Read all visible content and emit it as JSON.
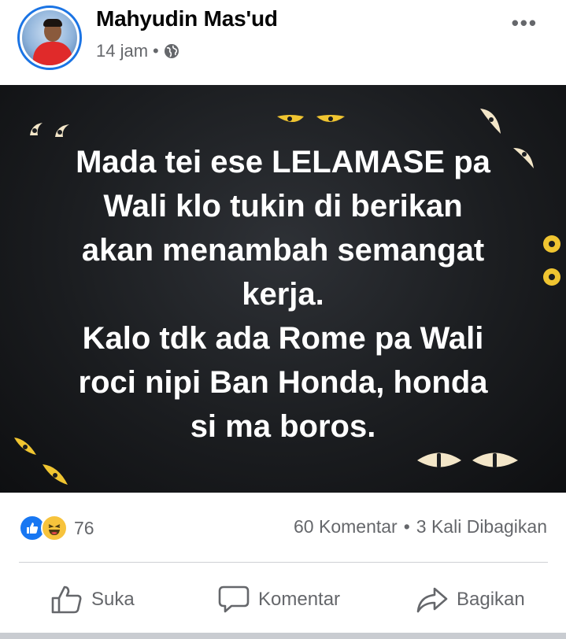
{
  "post": {
    "author": "Mahyudin Mas'ud",
    "time": "14 jam",
    "separator": "•",
    "privacy_icon": "globe-icon",
    "more_label": "•••"
  },
  "image_text": {
    "lines": [
      "Mada tei ese LELAMASE pa",
      "Wali klo tukin di berikan",
      "akan menambah semangat",
      "kerja.",
      "Kalo tdk ada Rome pa Wali",
      "roci nipi Ban Honda, honda",
      "si ma boros."
    ]
  },
  "stats": {
    "reaction_icons": [
      "like-icon",
      "haha-icon"
    ],
    "reaction_count": "76",
    "comments": "60 Komentar",
    "dot": "•",
    "shares": "3 Kali Dibagikan"
  },
  "actions": {
    "like": "Suka",
    "comment": "Komentar",
    "share": "Bagikan"
  },
  "colors": {
    "brand_blue": "#1877f2",
    "meta_gray": "#65676b",
    "eye_yellow": "#f0c531",
    "eye_cream": "#f3e6c8"
  }
}
